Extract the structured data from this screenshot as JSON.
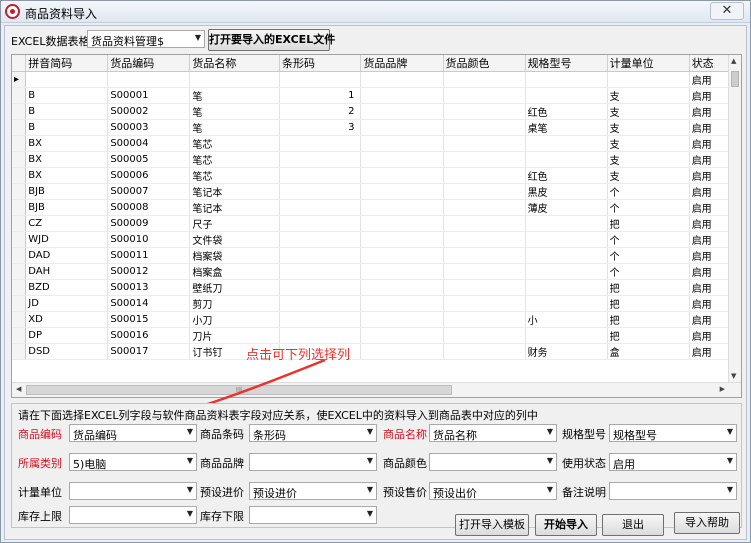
{
  "window": {
    "title": "商品资料导入",
    "close_glyph": "✕"
  },
  "toolbar": {
    "sheet_label": "EXCEL数据表格",
    "sheet_value": "货品资料管理$",
    "open_button": "打开要导入的EXCEL文件"
  },
  "grid": {
    "columns": [
      "拼音简码",
      "货品编码",
      "货品名称",
      "条形码",
      "货品品牌",
      "货品颜色",
      "规格型号",
      "计量单位",
      "状态"
    ],
    "new_row_marker": "▸",
    "rows": [
      [
        "",
        "",
        "",
        "",
        "",
        "",
        "",
        "",
        "启用"
      ],
      [
        "B",
        "S00001",
        "笔",
        "1",
        "",
        "",
        "",
        "支",
        "启用"
      ],
      [
        "B",
        "S00002",
        "笔",
        "2",
        "",
        "",
        "红色",
        "支",
        "启用"
      ],
      [
        "B",
        "S00003",
        "笔",
        "3",
        "",
        "",
        "桌笔",
        "支",
        "启用"
      ],
      [
        "BX",
        "S00004",
        "笔芯",
        "",
        "",
        "",
        "",
        "支",
        "启用"
      ],
      [
        "BX",
        "S00005",
        "笔芯",
        "",
        "",
        "",
        "",
        "支",
        "启用"
      ],
      [
        "BX",
        "S00006",
        "笔芯",
        "",
        "",
        "",
        "红色",
        "支",
        "启用"
      ],
      [
        "BJB",
        "S00007",
        "笔记本",
        "",
        "",
        "",
        "黑皮",
        "个",
        "启用"
      ],
      [
        "BJB",
        "S00008",
        "笔记本",
        "",
        "",
        "",
        "薄皮",
        "个",
        "启用"
      ],
      [
        "CZ",
        "S00009",
        "尺子",
        "",
        "",
        "",
        "",
        "把",
        "启用"
      ],
      [
        "WJD",
        "S00010",
        "文件袋",
        "",
        "",
        "",
        "",
        "个",
        "启用"
      ],
      [
        "DAD",
        "S00011",
        "档案袋",
        "",
        "",
        "",
        "",
        "个",
        "启用"
      ],
      [
        "DAH",
        "S00012",
        "档案盒",
        "",
        "",
        "",
        "",
        "个",
        "启用"
      ],
      [
        "BZD",
        "S00013",
        "壁纸刀",
        "",
        "",
        "",
        "",
        "把",
        "启用"
      ],
      [
        "JD",
        "S00014",
        "剪刀",
        "",
        "",
        "",
        "",
        "把",
        "启用"
      ],
      [
        "XD",
        "S00015",
        "小刀",
        "",
        "",
        "",
        "小",
        "把",
        "启用"
      ],
      [
        "DP",
        "S00016",
        "刀片",
        "",
        "",
        "",
        "",
        "把",
        "启用"
      ],
      [
        "DSD",
        "S00017",
        "订书钉",
        "",
        "",
        "",
        "财务",
        "盒",
        "启用"
      ]
    ],
    "hscroll_grip": "III"
  },
  "annotation": "点击可下列选择列",
  "mapping": {
    "hint": "请在下面选择EXCEL列字段与软件商品资料表字段对应关系，使EXCEL中的资料导入到商品表中对应的列中",
    "fields": {
      "goods_code": {
        "label": "商品编码",
        "value": "货品编码"
      },
      "barcode": {
        "label": "商品条码",
        "value": "条形码"
      },
      "goods_name": {
        "label": "商品名称",
        "value": "货品名称"
      },
      "spec": {
        "label": "规格型号",
        "value": "规格型号"
      },
      "category": {
        "label": "所属类别",
        "value": "5)电脑"
      },
      "brand": {
        "label": "商品品牌",
        "value": ""
      },
      "color": {
        "label": "商品颜色",
        "value": ""
      },
      "status": {
        "label": "使用状态",
        "value": "启用"
      },
      "unit": {
        "label": "计量单位",
        "value": ""
      },
      "purchase_price": {
        "label": "预设进价",
        "value": "预设进价"
      },
      "sale_price": {
        "label": "预设售价",
        "value": "预设出价"
      },
      "remark": {
        "label": "备注说明",
        "value": ""
      },
      "stock_max": {
        "label": "库存上限",
        "value": ""
      },
      "stock_min": {
        "label": "库存下限",
        "value": ""
      }
    }
  },
  "buttons": {
    "open_template": "打开导入模板",
    "start_import": "开始导入",
    "exit": "退出",
    "help": "导入帮助"
  },
  "colors": {
    "required_label": "#d4101f",
    "annotation": "#e8332e"
  }
}
